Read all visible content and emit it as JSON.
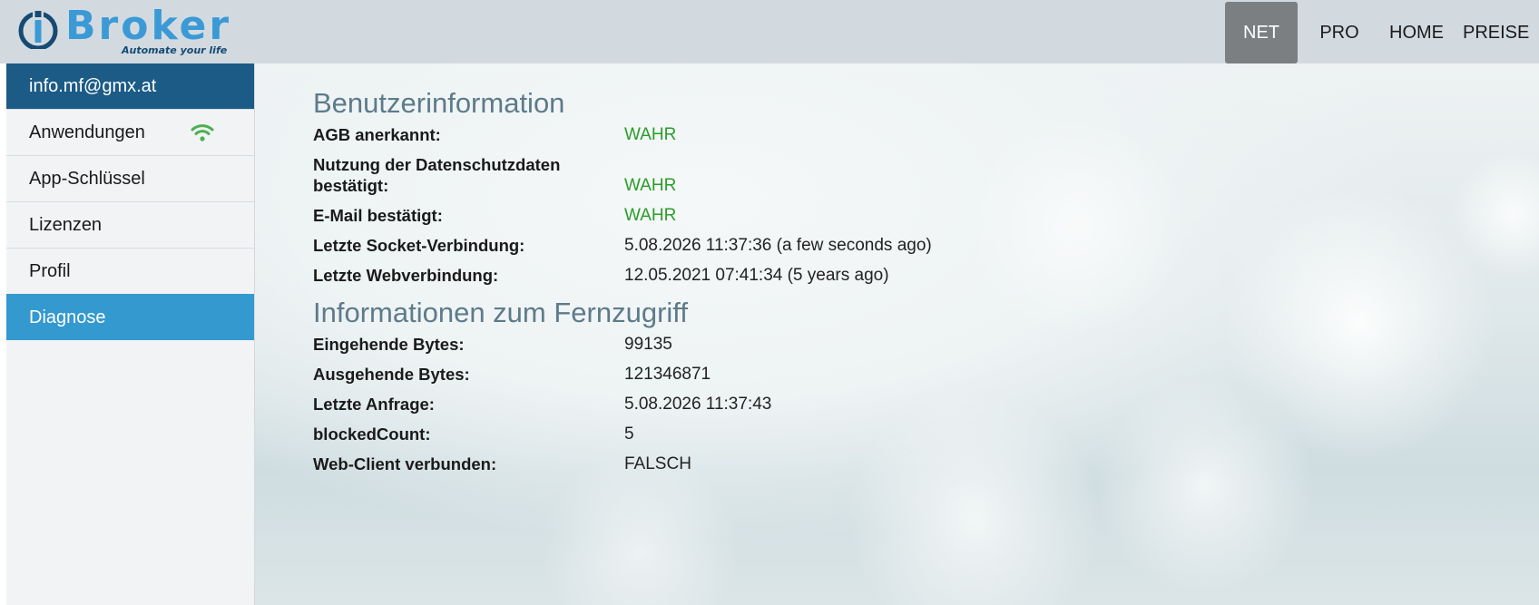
{
  "header": {
    "logo_word": "Broker",
    "logo_tagline": "Automate your life",
    "nav": [
      {
        "label": "NET",
        "active": true
      },
      {
        "label": "PRO",
        "active": false
      },
      {
        "label": "HOME",
        "active": false
      },
      {
        "label": "PREISE",
        "active": false
      }
    ]
  },
  "sidebar": {
    "user_email": "info.mf@gmx.at",
    "items": [
      {
        "label": "Anwendungen",
        "icon": "wifi-icon"
      },
      {
        "label": "App-Schlüssel"
      },
      {
        "label": "Lizenzen"
      },
      {
        "label": "Profil"
      },
      {
        "label": "Diagnose",
        "active": true
      }
    ]
  },
  "main": {
    "user_info": {
      "title": "Benutzerinformation",
      "rows": [
        {
          "label": "AGB anerkannt:",
          "value": "WAHR"
        },
        {
          "label": "Nutzung der Datenschutzdaten bestätigt:",
          "value": "WAHR"
        },
        {
          "label": "E-Mail bestätigt:",
          "value": "WAHR"
        },
        {
          "label": "Letzte Socket-Verbindung:",
          "value": "5.08.2026 11:37:36 (a few seconds ago)"
        },
        {
          "label": "Letzte Webverbindung:",
          "value": "12.05.2021 07:41:34 (5 years ago)"
        }
      ]
    },
    "remote_info": {
      "title": "Informationen zum Fernzugriff",
      "rows": [
        {
          "label": "Eingehende Bytes:",
          "value": "99135"
        },
        {
          "label": "Ausgehende Bytes:",
          "value": "121346871"
        },
        {
          "label": "Letzte Anfrage:",
          "value": "5.08.2026 11:37:43"
        },
        {
          "label": "blockedCount:",
          "value": "5"
        },
        {
          "label": "Web-Client verbunden:",
          "value": "FALSCH"
        }
      ]
    }
  },
  "colors": {
    "header_bg": "#d2dae0",
    "logo_blue": "#3b9ad6",
    "sidebar_user_bg": "#1b5b86",
    "sidebar_active_bg": "#3499cf",
    "nav_active_bg": "#7b7f82",
    "true_value": "#2a9d2a",
    "section_title": "#5d7b8a",
    "wifi_icon": "#4caf50"
  }
}
